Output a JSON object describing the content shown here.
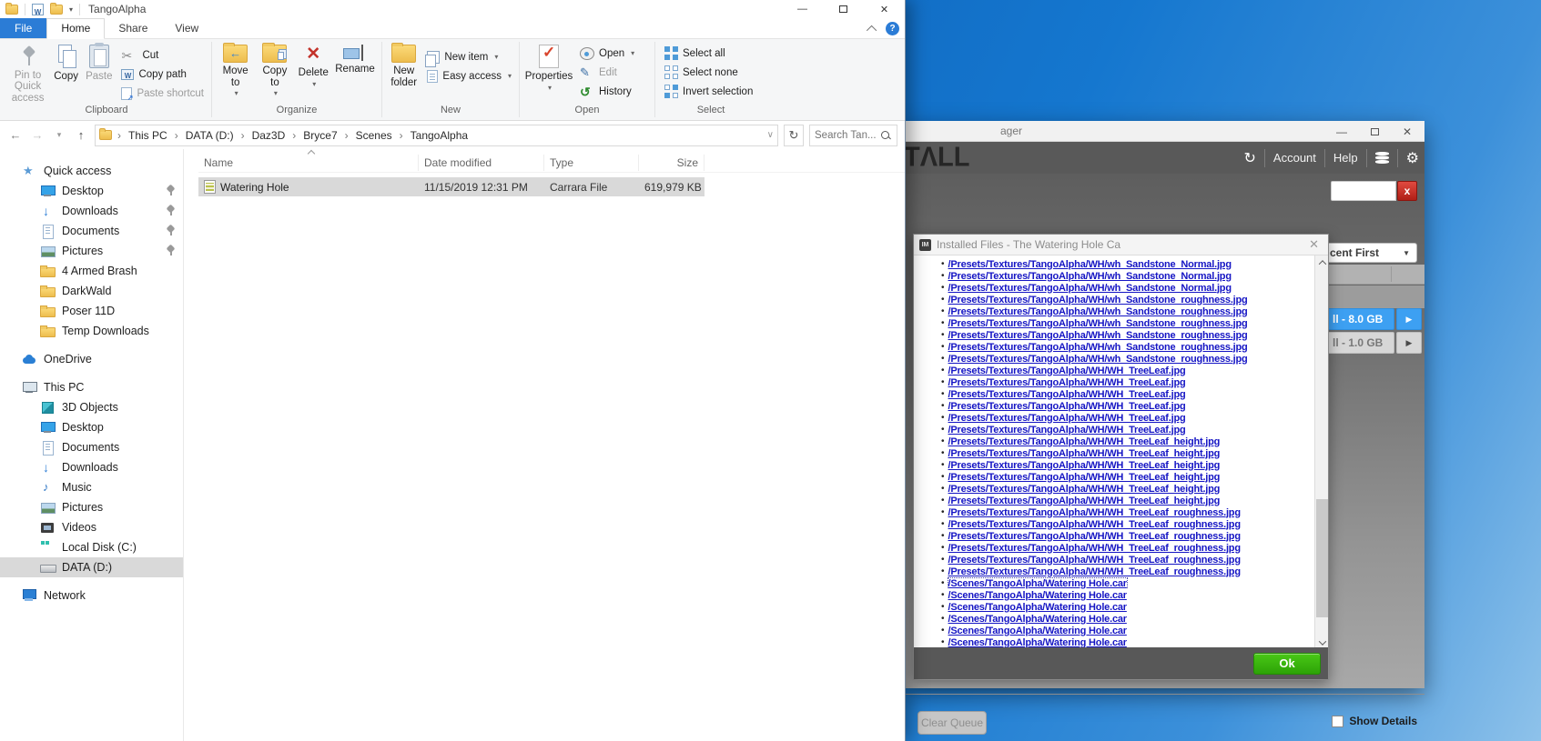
{
  "explorer": {
    "window_title": "TangoAlpha",
    "tabs": {
      "file": "File",
      "home": "Home",
      "share": "Share",
      "view": "View"
    },
    "ribbon": {
      "pin": "Pin to Quick access",
      "copy": "Copy",
      "paste": "Paste",
      "cut": "Cut",
      "copy_path": "Copy path",
      "paste_shortcut": "Paste shortcut",
      "move_to": "Move to",
      "copy_to": "Copy to",
      "delete": "Delete",
      "rename": "Rename",
      "new_folder": "New folder",
      "new_item": "New item",
      "easy_access": "Easy access",
      "properties": "Properties",
      "open": "Open",
      "edit": "Edit",
      "history": "History",
      "select_all": "Select all",
      "select_none": "Select none",
      "invert_selection": "Invert selection",
      "groups": [
        "Clipboard",
        "Organize",
        "New",
        "Open",
        "Select"
      ]
    },
    "address": {
      "breadcrumb": [
        "This PC",
        "DATA (D:)",
        "Daz3D",
        "Bryce7",
        "Scenes",
        "TangoAlpha"
      ],
      "search_placeholder": "Search Tan..."
    },
    "list": {
      "columns": [
        "Name",
        "Date modified",
        "Type",
        "Size"
      ],
      "rows": [
        {
          "name": "Watering Hole",
          "modified": "11/15/2019 12:31 PM",
          "type": "Carrara File",
          "size": "619,979 KB"
        }
      ]
    },
    "sidebar": {
      "items": [
        {
          "label": "Quick access",
          "icon": "star",
          "level": 0
        },
        {
          "label": "Desktop",
          "icon": "mon",
          "level": 1,
          "pinned": true
        },
        {
          "label": "Downloads",
          "icon": "down",
          "level": 1,
          "pinned": true
        },
        {
          "label": "Documents",
          "icon": "doc",
          "level": 1,
          "pinned": true
        },
        {
          "label": "Pictures",
          "icon": "pic",
          "level": 1,
          "pinned": true
        },
        {
          "label": "4 Armed Brash",
          "icon": "fold",
          "level": 1
        },
        {
          "label": "DarkWald",
          "icon": "fold",
          "level": 1
        },
        {
          "label": "Poser 11D",
          "icon": "fold",
          "level": 1
        },
        {
          "label": "Temp Downloads",
          "icon": "fold",
          "level": 1
        },
        {
          "label": "OneDrive",
          "icon": "cloud",
          "level": 0,
          "gap": true
        },
        {
          "label": "This PC",
          "icon": "pc",
          "level": 0,
          "gap": true
        },
        {
          "label": "3D Objects",
          "icon": "cube",
          "level": 1
        },
        {
          "label": "Desktop",
          "icon": "mon",
          "level": 1
        },
        {
          "label": "Documents",
          "icon": "doc",
          "level": 1
        },
        {
          "label": "Downloads",
          "icon": "down",
          "level": 1
        },
        {
          "label": "Music",
          "icon": "music",
          "level": 1
        },
        {
          "label": "Pictures",
          "icon": "pic",
          "level": 1
        },
        {
          "label": "Videos",
          "icon": "film",
          "level": 1
        },
        {
          "label": "Local Disk (C:)",
          "icon": "diskc",
          "level": 1
        },
        {
          "label": "DATA (D:)",
          "icon": "disk",
          "level": 1,
          "selected": true
        },
        {
          "label": "Network",
          "icon": "net",
          "level": 0,
          "gap": true
        }
      ]
    }
  },
  "dim": {
    "title_fragment": "ager",
    "logo_fragment": "TΛLL",
    "menu": {
      "account": "Account",
      "help": "Help"
    },
    "sort_fragment": "cent First",
    "products": [
      {
        "label": "ll - 8.0 GB",
        "selected": true
      },
      {
        "label": "ll - 1.0 GB",
        "selected": false
      }
    ],
    "buttons": {
      "clear_queue": "Clear Queue",
      "ok": "Ok"
    },
    "show_details_label": "Show Details",
    "dialog": {
      "title": "Installed Files - The Watering Hole Ca",
      "icon_label": "IM",
      "focus_index": 27,
      "files": [
        "/Presets/Textures/TangoAlpha/WH/wh_Sandstone_Normal.jpg",
        "/Presets/Textures/TangoAlpha/WH/wh_Sandstone_Normal.jpg",
        "/Presets/Textures/TangoAlpha/WH/wh_Sandstone_Normal.jpg",
        "/Presets/Textures/TangoAlpha/WH/wh_Sandstone_roughness.jpg",
        "/Presets/Textures/TangoAlpha/WH/wh_Sandstone_roughness.jpg",
        "/Presets/Textures/TangoAlpha/WH/wh_Sandstone_roughness.jpg",
        "/Presets/Textures/TangoAlpha/WH/wh_Sandstone_roughness.jpg",
        "/Presets/Textures/TangoAlpha/WH/wh_Sandstone_roughness.jpg",
        "/Presets/Textures/TangoAlpha/WH/wh_Sandstone_roughness.jpg",
        "/Presets/Textures/TangoAlpha/WH/WH_TreeLeaf.jpg",
        "/Presets/Textures/TangoAlpha/WH/WH_TreeLeaf.jpg",
        "/Presets/Textures/TangoAlpha/WH/WH_TreeLeaf.jpg",
        "/Presets/Textures/TangoAlpha/WH/WH_TreeLeaf.jpg",
        "/Presets/Textures/TangoAlpha/WH/WH_TreeLeaf.jpg",
        "/Presets/Textures/TangoAlpha/WH/WH_TreeLeaf.jpg",
        "/Presets/Textures/TangoAlpha/WH/WH_TreeLeaf_height.jpg",
        "/Presets/Textures/TangoAlpha/WH/WH_TreeLeaf_height.jpg",
        "/Presets/Textures/TangoAlpha/WH/WH_TreeLeaf_height.jpg",
        "/Presets/Textures/TangoAlpha/WH/WH_TreeLeaf_height.jpg",
        "/Presets/Textures/TangoAlpha/WH/WH_TreeLeaf_height.jpg",
        "/Presets/Textures/TangoAlpha/WH/WH_TreeLeaf_height.jpg",
        "/Presets/Textures/TangoAlpha/WH/WH_TreeLeaf_roughness.jpg",
        "/Presets/Textures/TangoAlpha/WH/WH_TreeLeaf_roughness.jpg",
        "/Presets/Textures/TangoAlpha/WH/WH_TreeLeaf_roughness.jpg",
        "/Presets/Textures/TangoAlpha/WH/WH_TreeLeaf_roughness.jpg",
        "/Presets/Textures/TangoAlpha/WH/WH_TreeLeaf_roughness.jpg",
        "/Presets/Textures/TangoAlpha/WH/WH_TreeLeaf_roughness.jpg",
        "/Scenes/TangoAlpha/Watering Hole.car",
        "/Scenes/TangoAlpha/Watering Hole.car",
        "/Scenes/TangoAlpha/Watering Hole.car",
        "/Scenes/TangoAlpha/Watering Hole.car",
        "/Scenes/TangoAlpha/Watering Hole.car",
        "/Scenes/TangoAlpha/Watering Hole.car"
      ]
    }
  }
}
